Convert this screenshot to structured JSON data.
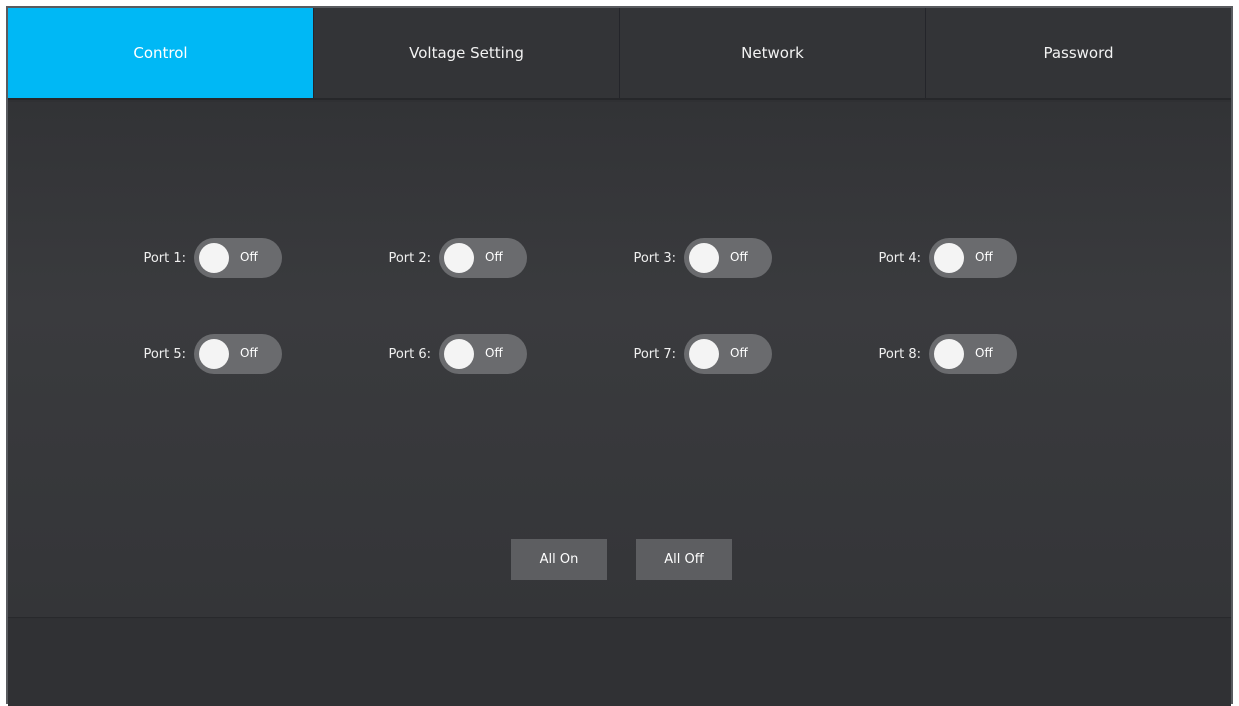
{
  "tabs": [
    {
      "label": "Control",
      "active": true
    },
    {
      "label": "Voltage Setting",
      "active": false
    },
    {
      "label": "Network",
      "active": false
    },
    {
      "label": "Password",
      "active": false
    }
  ],
  "ports": [
    {
      "label": "Port 1:",
      "state": "Off"
    },
    {
      "label": "Port 2:",
      "state": "Off"
    },
    {
      "label": "Port 3:",
      "state": "Off"
    },
    {
      "label": "Port 4:",
      "state": "Off"
    },
    {
      "label": "Port 5:",
      "state": "Off"
    },
    {
      "label": "Port 6:",
      "state": "Off"
    },
    {
      "label": "Port 7:",
      "state": "Off"
    },
    {
      "label": "Port 8:",
      "state": "Off"
    }
  ],
  "actions": {
    "all_on": "All On",
    "all_off": "All Off"
  },
  "colors": {
    "accent": "#00b8f5",
    "background": "#2f3033",
    "toggle_off": "#6a6b6e"
  }
}
